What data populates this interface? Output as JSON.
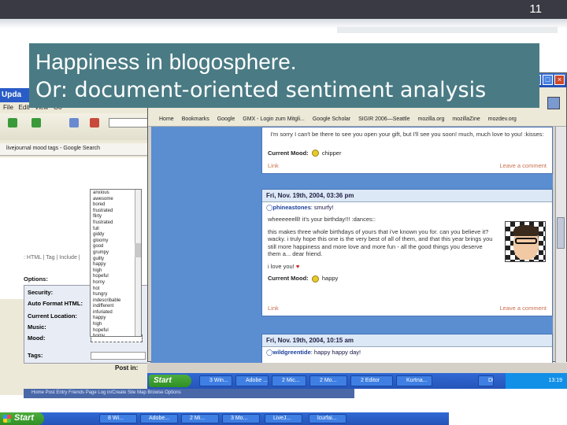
{
  "slide": {
    "number": "11",
    "title_line1": "Happiness in blogosphere.",
    "title_line2": "Or: document-oriented sentiment analysis"
  },
  "left_window": {
    "title": "Upda",
    "tab_label": "livejournal mood tags - Google Search",
    "html_label": ": HTML | Tag | Include |",
    "mood_options": [
      "anxious",
      "awesome",
      "bored",
      "frustrated",
      "flirty",
      "frustrated",
      "full",
      "giddy",
      "gloomy",
      "good",
      "grumpy",
      "guilty",
      "happy",
      "high",
      "hopeful",
      "horny",
      "hot",
      "hungry",
      "indescribable",
      "indifferent",
      "infuriated",
      "happy",
      "high",
      "hopeful",
      "horny"
    ],
    "options_title": "Options:",
    "fields": [
      {
        "label": "Security:"
      },
      {
        "label": "Auto Format HTML:"
      },
      {
        "label": "Current Location:"
      },
      {
        "label": "Music:"
      },
      {
        "label": "Mood:"
      },
      {
        "label": "Tags:"
      }
    ],
    "post_in": "Post in:"
  },
  "browser": {
    "bookmarks": [
      "Home",
      "Bookmarks",
      "Google",
      "GMX - Login zum Mitgli...",
      "Google Scholar",
      "SIGIR 2006—Seattle",
      "mozilla.org",
      "mozillaZine",
      "mozdev.org"
    ],
    "entries": [
      {
        "body": [
          "I'm sorry I can't be there to see you open your gift, but I'll see you soon! much, much love to you! :kisses:"
        ],
        "mood_label": "Current Mood:",
        "mood_value": "chipper",
        "link_left": "Link",
        "link_right": "Leave a comment"
      },
      {
        "date": "Fri, Nov. 19th, 2004, 03:36 pm",
        "user": "phineastones",
        "subject": ": smurfy!",
        "body": [
          "wheeeeeelll! it's your birthday!!! :dances::",
          "this makes three whole birthdays of yours that i've known you for. can you believe it? wacky. i truly hope this one is the very best of all of them, and that this year brings you still more happiness and more love and more fun - all the good things you deserve them a... dear friend.",
          "i love you!"
        ],
        "mood_label": "Current Mood:",
        "mood_value": "happy",
        "link_left": "Link",
        "link_right": "Leave a comment"
      },
      {
        "date": "Fri, Nov. 19th, 2004, 10:15 am",
        "user": "wildgreentide",
        "subject": ": happy happy day!"
      }
    ]
  },
  "inner_taskbar": {
    "start": "Start",
    "items": [
      "3 Win...",
      "Adobe ...",
      "2 Mic...",
      "2 Mo...",
      "2 Editor",
      "Kurtna...",
      "DE"
    ],
    "clock": "13:19"
  },
  "outer_taskbar": {
    "start": "Start",
    "items": [
      "8 Wi...",
      "Adobe...",
      "2 Mi...",
      "3 Mo...",
      "LiveJ...",
      "lcurfai..."
    ]
  },
  "status_bar": "Home  Post Entry  Friends Page  Log in/Create  Site Map  Browse Options"
}
